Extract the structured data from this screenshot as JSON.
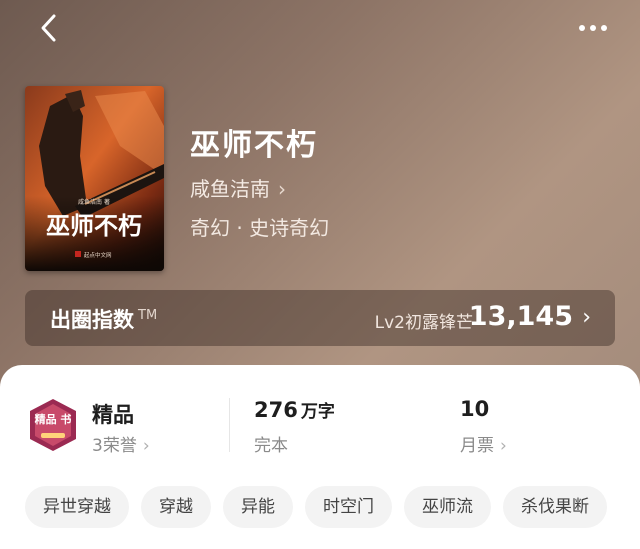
{
  "nav": {
    "back_icon": "chevron-left-icon",
    "more_icon": "more-dots-icon"
  },
  "book": {
    "title": "巫师不朽",
    "author": "咸鱼洁南",
    "genre": "奇幻 · 史诗奇幻",
    "cover": {
      "title_text": "巫师不朽",
      "author_small": "咸鱼洁南 著",
      "publisher": "起点中文网"
    }
  },
  "index": {
    "label": "出圈指数",
    "tm": "TM",
    "level": "Lv2初露锋芒",
    "value": "13,145"
  },
  "stats": {
    "quality": {
      "main": "精品",
      "sub": "3荣誉"
    },
    "words": {
      "main": "276",
      "unit": "万字",
      "sub": "完本"
    },
    "tickets": {
      "main": "10",
      "sub": "月票"
    }
  },
  "badge": {
    "text": "精品 书"
  },
  "tags": [
    "异世穿越",
    "穿越",
    "异能",
    "时空门",
    "巫师流",
    "杀伐果断"
  ],
  "colors": {
    "hero": "#8d7466",
    "accent_red": "#c4261f",
    "badge_purple": "#9b2a52"
  }
}
